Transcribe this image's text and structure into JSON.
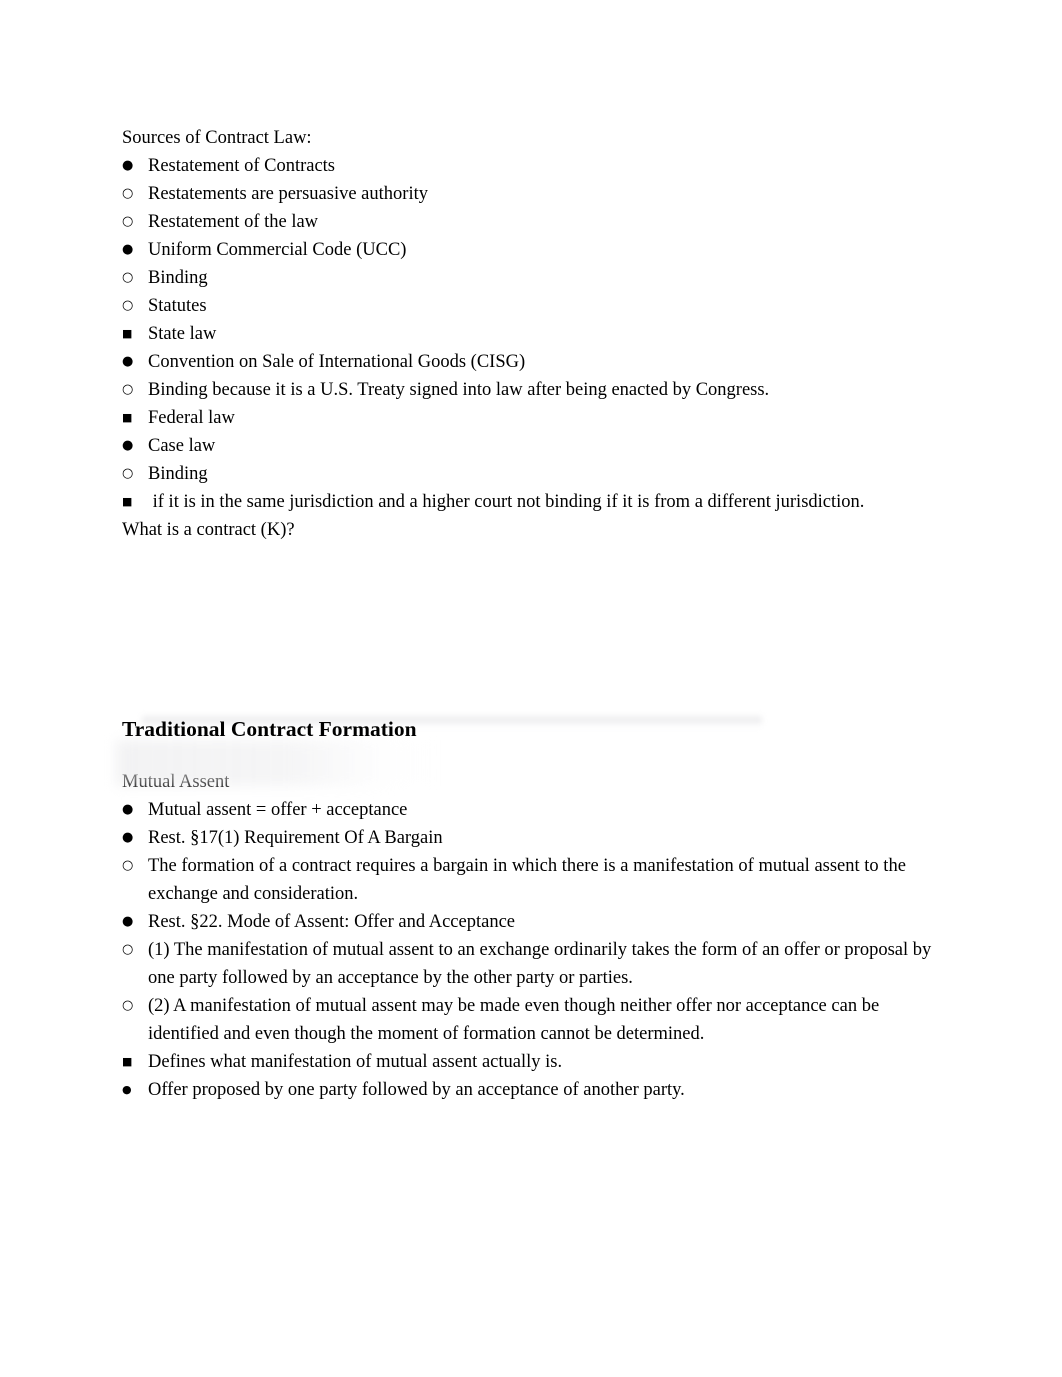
{
  "document": {
    "page_background": "#ffffff",
    "text_color": "#000000"
  },
  "bullets": {
    "disc": "●",
    "circle": "○",
    "square": "■",
    "disc_small": "●"
  },
  "section_one": {
    "heading": "Sources of Contract Law:",
    "items": [
      {
        "level": 1,
        "marker": "disc",
        "text": "Restatement of Contracts"
      },
      {
        "level": 2,
        "marker": "circle",
        "text": "Restatements are persuasive authority"
      },
      {
        "level": 2,
        "marker": "circle",
        "text": "Restatement of the law"
      },
      {
        "level": 1,
        "marker": "disc",
        "text": "Uniform Commercial Code (UCC)"
      },
      {
        "level": 2,
        "marker": "circle",
        "text": "Binding"
      },
      {
        "level": 2,
        "marker": "circle",
        "text": "Statutes"
      },
      {
        "level": 3,
        "marker": "square",
        "text": "State law"
      },
      {
        "level": 1,
        "marker": "disc",
        "text": "Convention on Sale of International Goods (CISG)"
      },
      {
        "level": 2,
        "marker": "circle",
        "text": "Binding because it is a U.S. Treaty signed into law after being enacted by Congress."
      },
      {
        "level": 3,
        "marker": "square",
        "text": "Federal law"
      },
      {
        "level": 1,
        "marker": "disc",
        "text": "Case law"
      },
      {
        "level": 2,
        "marker": "circle",
        "text": "Binding"
      },
      {
        "level": 3,
        "marker": "square",
        "text": " if it is in the same jurisdiction and a higher court not binding if it is from a different jurisdiction."
      }
    ],
    "closing_line": "What is a contract (K)?"
  },
  "section_two": {
    "title": "Traditional Contract Formation",
    "subheading": "Mutual Assent",
    "items": [
      {
        "level": 1,
        "marker": "disc",
        "text": "Mutual assent = offer + acceptance"
      },
      {
        "level": 1,
        "marker": "disc",
        "text": "Rest. §17(1) Requirement Of A Bargain"
      },
      {
        "level": 2,
        "marker": "circle",
        "text": "The formation of a contract requires a bargain in which there is a manifestation of mutual assent to the exchange and consideration."
      },
      {
        "level": 1,
        "marker": "disc",
        "text": "Rest. §22. Mode of Assent: Offer and Acceptance"
      },
      {
        "level": 2,
        "marker": "circle",
        "text": "(1) The manifestation of mutual assent to an exchange ordinarily takes the form of an offer or proposal by one party followed by an acceptance by the other party or parties."
      },
      {
        "level": 2,
        "marker": "circle",
        "text": "(2) A manifestation of mutual assent may be made even though neither offer nor acceptance can be identified and even though the moment of formation cannot be determined."
      },
      {
        "level": 3,
        "marker": "square",
        "text": "Defines what manifestation of mutual assent actually is."
      },
      {
        "level": 4,
        "marker": "disc_small",
        "text": "Offer proposed by one party followed by an acceptance of another party."
      }
    ]
  }
}
